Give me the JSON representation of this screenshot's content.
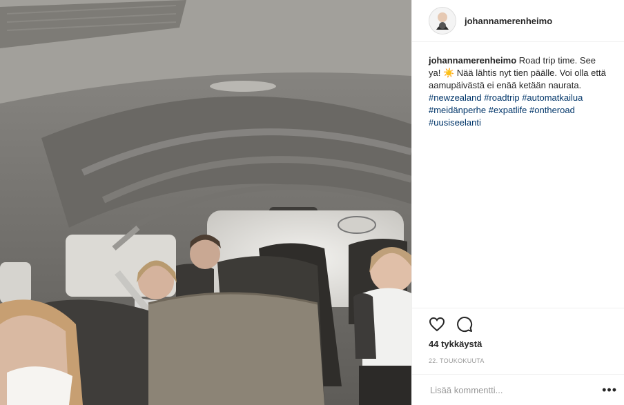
{
  "post": {
    "username": "johannamerenheimo",
    "caption": {
      "username": "johannamerenheimo",
      "text": "Road trip time. See ya! ☀️ Nää lähtis nyt tien päälle. Voi olla että aamupäivästä ei enää ketään naurata.",
      "hashtags": [
        "#newzealand",
        "#roadtrip",
        "#automatkailua",
        "#meidänperhe",
        "#expatlife",
        "#ontheroad",
        "#uusiseelanti"
      ]
    },
    "likes": "44 tykkäystä",
    "date": "22. TOUKOKUUTA",
    "comment_placeholder": "Lisää kommentti...",
    "more_label": "•••"
  },
  "icons": {
    "like": "heart-icon",
    "comment": "comment-icon",
    "more": "more-options-icon"
  }
}
